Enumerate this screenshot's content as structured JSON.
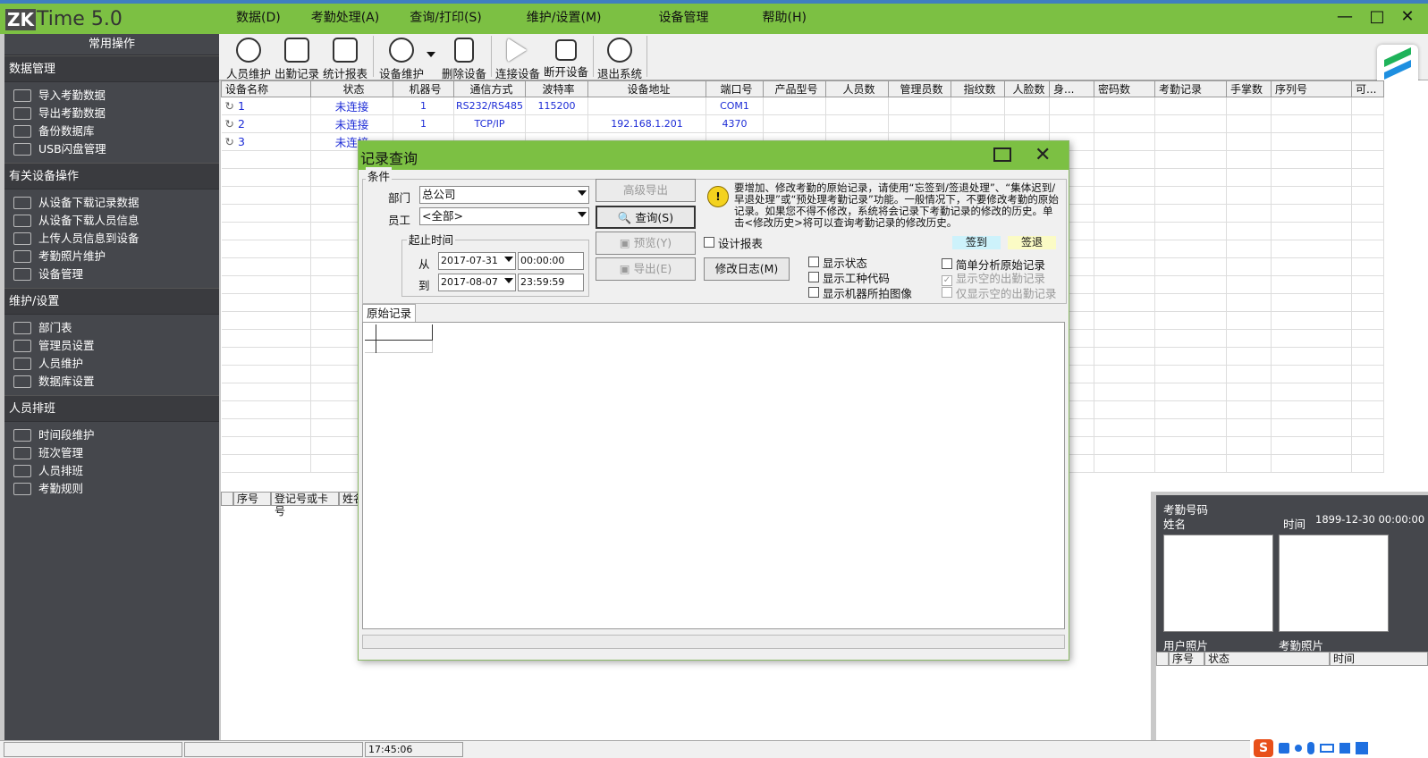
{
  "app": {
    "logo_zk": "ZK",
    "logo_time": "Time 5.0"
  },
  "menu": [
    "数据(D)",
    "考勤处理(A)",
    "查询/打印(S)",
    "维护/设置(M)",
    "设备管理",
    "帮助(H)"
  ],
  "sidebar": {
    "header": "常用操作",
    "groups": [
      {
        "title": "数据管理",
        "items": [
          "导入考勤数据",
          "导出考勤数据",
          "备份数据库",
          "USB闪盘管理"
        ]
      },
      {
        "title": "有关设备操作",
        "items": [
          "从设备下载记录数据",
          "从设备下载人员信息",
          "上传人员信息到设备",
          "考勤照片维护",
          "设备管理"
        ]
      },
      {
        "title": "维护/设置",
        "items": [
          "部门表",
          "管理员设置",
          "人员维护",
          "数据库设置"
        ]
      },
      {
        "title": "人员排班",
        "items": [
          "时间段维护",
          "班次管理",
          "人员排班",
          "考勤规则"
        ]
      }
    ]
  },
  "toolbar": [
    "人员维护",
    "出勤记录",
    "统计报表",
    "设备维护",
    "删除设备",
    "连接设备",
    "断开设备",
    "退出系统"
  ],
  "grid": {
    "columns": [
      "设备名称",
      "状态",
      "机器号",
      "通信方式",
      "波特率",
      "设备地址",
      "端口号",
      "产品型号",
      "人员数",
      "管理员数",
      "指纹数",
      "人脸数",
      "身...",
      "密码数",
      "考勤记录",
      "手掌数",
      "序列号",
      "可..."
    ],
    "rows": [
      [
        "1",
        "未连接",
        "1",
        "RS232/RS485",
        "115200",
        "",
        "COM1"
      ],
      [
        "2",
        "未连接",
        "1",
        "TCP/IP",
        "",
        "192.168.1.201",
        "4370"
      ],
      [
        "3",
        "未连接",
        "",
        "",
        "",
        "",
        ""
      ]
    ]
  },
  "lower_table": {
    "columns": [
      "序号",
      "登记号或卡号",
      "姓名"
    ]
  },
  "right_panel": {
    "att_no_label": "考勤号码",
    "name_label": "姓名",
    "time_label": "时间",
    "time_value": "1899-12-30 00:00:00",
    "user_photo_label": "用户照片",
    "att_photo_label": "考勤照片",
    "columns": [
      "序号",
      "状态",
      "时间"
    ]
  },
  "status": {
    "time": "17:45:06"
  },
  "dialog": {
    "title": "记录查询",
    "conditions_label": "条件",
    "dept_label": "部门",
    "dept_value": "总公司",
    "emp_label": "员工",
    "emp_value": "<全部>",
    "range_label": "起止时间",
    "from_label": "从",
    "to_label": "到",
    "from_date": "2017-07-31",
    "from_time": "00:00:00",
    "to_date": "2017-08-07",
    "to_time": "23:59:59",
    "btn_advanced_export": "高级导出",
    "btn_query": "查询(S)",
    "btn_preview": "预览(Y)",
    "btn_export": "导出(E)",
    "btn_modify_log": "修改日志(M)",
    "design_report": "设计报表",
    "notice": "要增加、修改考勤的原始记录，请使用“忘签到/签退处理”、“集体迟到/早退处理”或“预处理考勤记录”功能。一般情况下，不要修改考勤的原始记录。如果您不得不修改，系统将会记录下考勤记录的修改的历史。单击<修改历史>将可以查询考勤记录的修改历史。",
    "legend_signin": "签到",
    "legend_signout": "签退",
    "show_status": "显示状态",
    "show_work_code": "显示工种代码",
    "show_machine_image": "显示机器所拍图像",
    "simple_analysis": "简单分析原始记录",
    "show_empty": "显示空的出勤记录",
    "only_empty": "仅显示空的出勤记录",
    "tab_raw": "原始记录",
    "colors": {
      "signin": "#cdf2fb",
      "signout": "#fbfbc5"
    }
  }
}
